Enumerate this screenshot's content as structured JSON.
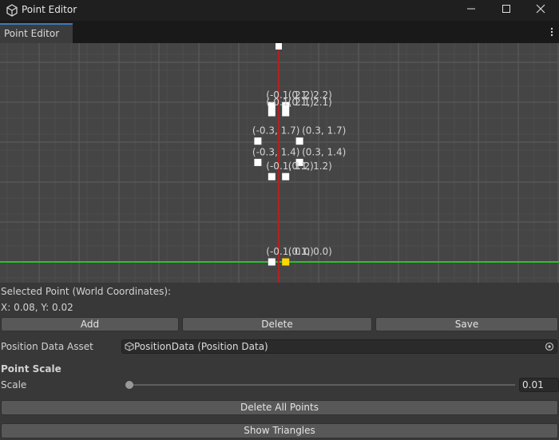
{
  "window": {
    "title": "Point Editor",
    "icon": "unity-cube-icon"
  },
  "tab": {
    "label": "Point Editor",
    "menu_icon": "kebab-menu-icon"
  },
  "graph": {
    "points": [
      {
        "label": "(-0.1, 2.2)",
        "x": -0.1,
        "y": 2.2
      },
      {
        "label": "(0.1, 2.2)",
        "x": 0.1,
        "y": 2.2
      },
      {
        "label": "(-0.1, 2.1)",
        "x": -0.1,
        "y": 2.1
      },
      {
        "label": "(0.1, 2.1)",
        "x": 0.1,
        "y": 2.1
      },
      {
        "label": "(-0.3, 1.7)",
        "x": -0.3,
        "y": 1.7
      },
      {
        "label": "(0.3, 1.7)",
        "x": 0.3,
        "y": 1.7
      },
      {
        "label": "(-0.3, 1.4)",
        "x": -0.3,
        "y": 1.4
      },
      {
        "label": "(0.3, 1.4)",
        "x": 0.3,
        "y": 1.4
      },
      {
        "label": "(-0.1, 1.2)",
        "x": -0.1,
        "y": 1.2
      },
      {
        "label": "(0.1, 1.2)",
        "x": 0.1,
        "y": 1.2
      },
      {
        "label": "(-0.1, 0.0)",
        "x": -0.1,
        "y": 0.0
      },
      {
        "label": "(0.1, 0.0)",
        "x": 0.1,
        "y": 0.0,
        "selected": true
      }
    ],
    "x_axis_color": "#2fbf2f",
    "y_axis_color": "#b02222",
    "selected_color": "#ffd700",
    "point_color": "#ffffff"
  },
  "selected": {
    "heading": "Selected Point (World Coordinates):",
    "coords": "X: 0.08, Y: 0.02"
  },
  "buttons": {
    "add": "Add",
    "delete": "Delete",
    "save": "Save"
  },
  "asset": {
    "label": "Position Data Asset",
    "value": "PositionData (Position Data)"
  },
  "scale": {
    "section": "Point Scale",
    "label": "Scale",
    "value": "0.01",
    "level": 0.01
  },
  "actions": {
    "delete_all": "Delete All Points",
    "show_triangles": "Show Triangles"
  }
}
